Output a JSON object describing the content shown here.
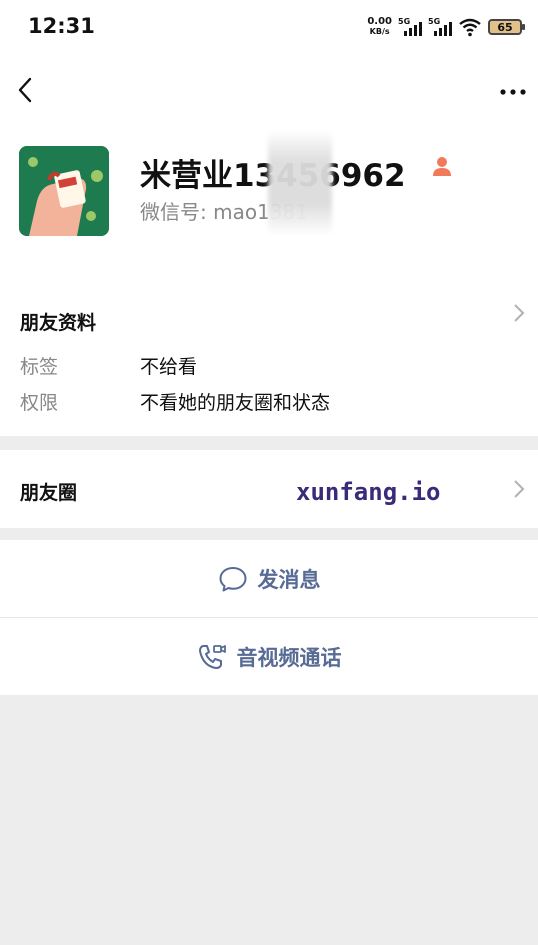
{
  "status_bar": {
    "time": "12:31",
    "net_speed_value": "0.00",
    "net_speed_unit": "KB/s",
    "signal1_label": "5G",
    "signal2_label": "5G",
    "battery": "65"
  },
  "profile": {
    "name": "米营业13456962",
    "wechat_id_label": "微信号: mao1381",
    "gender_icon": "female-person-icon"
  },
  "friend_info": {
    "title": "朋友资料",
    "rows": [
      {
        "label": "标签",
        "value": "不给看"
      },
      {
        "label": "权限",
        "value": "不看她的朋友圈和状态"
      }
    ]
  },
  "moments": {
    "title": "朋友圈",
    "watermark": "xunfang.io"
  },
  "actions": {
    "message_label": "发消息",
    "call_label": "音视频通话"
  },
  "colors": {
    "link_blue": "#576b95",
    "bg": "#ededed",
    "gender_orange": "#f07a5a"
  }
}
